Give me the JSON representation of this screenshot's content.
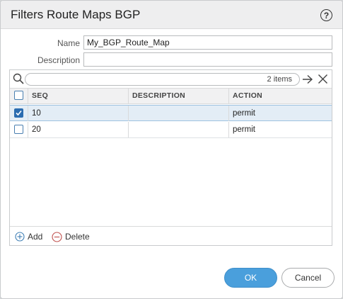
{
  "dialog": {
    "title": "Filters Route Maps BGP",
    "help_icon": "help-circle-icon"
  },
  "form": {
    "name_label": "Name",
    "name_value": "My_BGP_Route_Map",
    "description_label": "Description",
    "description_value": ""
  },
  "grid": {
    "search_placeholder": "",
    "items_count": "2 items",
    "columns": [
      "SEQ",
      "DESCRIPTION",
      "ACTION"
    ],
    "rows": [
      {
        "checked": true,
        "seq": "10",
        "description": "",
        "action": "permit"
      },
      {
        "checked": false,
        "seq": "20",
        "description": "",
        "action": "permit"
      }
    ],
    "add_label": "Add",
    "delete_label": "Delete"
  },
  "buttons": {
    "ok_label": "OK",
    "cancel_label": "Cancel"
  },
  "colors": {
    "accent": "#4a9fdc",
    "checkbox_checked": "#2b6cb0",
    "selected_row": "#e3edf6"
  }
}
